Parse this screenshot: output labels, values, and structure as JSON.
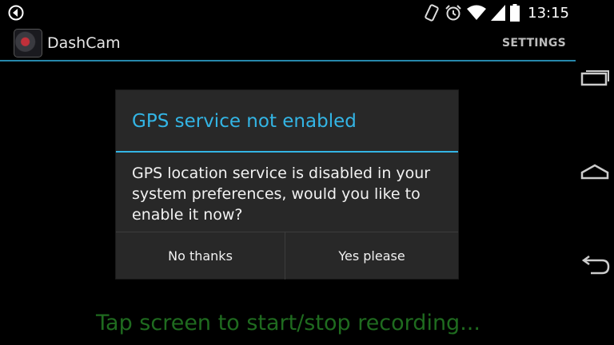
{
  "status_bar": {
    "time": "13:15",
    "icons": [
      "app-notification-icon",
      "vibrate-icon",
      "alarm-icon",
      "wifi-icon",
      "signal-icon",
      "battery-icon"
    ]
  },
  "action_bar": {
    "title": "DashCam",
    "settings_label": "SETTINGS",
    "accent_color": "#33b5e5"
  },
  "dialog": {
    "title": "GPS service not enabled",
    "message": "GPS location service is disabled in your system preferences, would you like to enable it now?",
    "negative_label": "No thanks",
    "positive_label": "Yes please"
  },
  "main": {
    "hint": "Tap screen to start/stop recording..."
  },
  "nav_bar": {
    "buttons": [
      "recent-apps-icon",
      "home-icon",
      "back-icon"
    ]
  }
}
